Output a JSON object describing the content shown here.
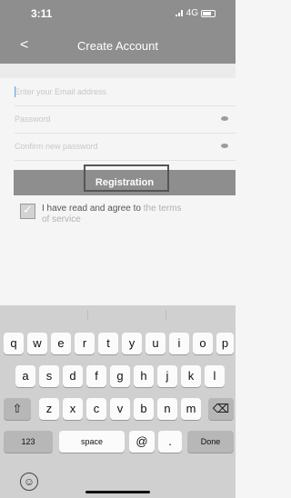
{
  "status_bar": {
    "time": "3:11",
    "network": "4G"
  },
  "nav": {
    "back_glyph": "<",
    "title": "Create Account"
  },
  "form": {
    "email_placeholder": "Enter your Email address",
    "password_placeholder": "Password",
    "confirm_placeholder": "Confirm new password"
  },
  "registration_label": "Registration",
  "agree": {
    "text": "I have read and agree to",
    "link_line1": "the terms",
    "link_line2": "of service"
  },
  "keyboard": {
    "row1": [
      "q",
      "w",
      "e",
      "r",
      "t",
      "y",
      "u",
      "i",
      "o",
      "p"
    ],
    "row2": [
      "a",
      "s",
      "d",
      "f",
      "g",
      "h",
      "j",
      "k",
      "l"
    ],
    "row3": [
      "z",
      "x",
      "c",
      "v",
      "b",
      "n",
      "m"
    ],
    "shift_glyph": "⇧",
    "backspace_glyph": "⌫",
    "numbers_label": "123",
    "space_label": "space",
    "at_label": "@",
    "dot_label": ".",
    "done_label": "Done",
    "emoji_glyph": "☺"
  },
  "colors": {
    "header": "#8e8e8e",
    "button": "#8e8e8e",
    "keyboard": "#d0d0d0"
  }
}
